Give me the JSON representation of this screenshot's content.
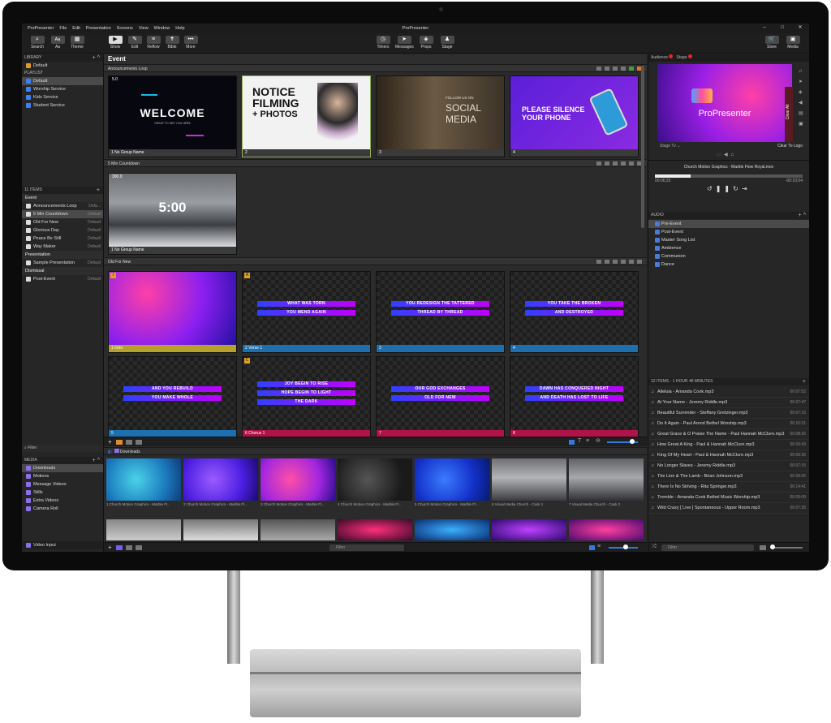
{
  "app": {
    "menu": [
      "ProPresenter",
      "File",
      "Edit",
      "Presentation",
      "Screens",
      "View",
      "Window",
      "Help"
    ],
    "title": "ProPresenter",
    "win_controls": [
      "–",
      "□",
      "✕"
    ]
  },
  "toolbar": {
    "left": [
      "Search",
      "Theme"
    ],
    "left2": [
      "Aa"
    ],
    "mid": [
      "Show",
      "Edit",
      "Reflow",
      "Bible",
      "More"
    ],
    "center": [
      "Timers",
      "Messages",
      "Props",
      "Stage"
    ],
    "right": [
      "Store",
      "Media"
    ],
    "aa_glyph": "Aa"
  },
  "library": {
    "header": "LIBRARY",
    "default": "Default",
    "playlist_header": "PLAYLIST",
    "playlists": [
      "Default",
      "Worship Service",
      "Kids Service",
      "Student Service"
    ]
  },
  "items": {
    "header": "11 ITEMS",
    "groups": [
      {
        "name": "Event",
        "rows": [
          [
            "Announcements Loop",
            "Defa..."
          ],
          [
            "5 Min Countdown",
            "Default"
          ],
          [
            "Old For New",
            "Default"
          ],
          [
            "Glorious Day",
            "Default"
          ],
          [
            "Peace Be Still",
            "Default"
          ],
          [
            "Way Maker",
            "Default"
          ]
        ]
      },
      {
        "name": "Presentation",
        "rows": [
          [
            "Sample Presentation",
            "Default"
          ]
        ]
      },
      {
        "name": "Dismissal",
        "rows": [
          [
            "Post-Event",
            "Default"
          ]
        ]
      }
    ]
  },
  "filter": "Filter",
  "media": {
    "header": "MEDIA",
    "items": [
      "Downloads",
      "Motions",
      "Message Videos",
      "Stills",
      "Extra Videos",
      "Camera Roll"
    ],
    "video_input": "Video Input"
  },
  "center": {
    "title": "Event",
    "g1": "Announcements Loop",
    "g1_badge": "5.0",
    "s1": {
      "welcome": "WELCOME",
      "welcome_sub": "GREAT TO SEE YOU HERE",
      "cap": "1  No Group Name"
    },
    "s2": {
      "l1": "NOTICE",
      "l2": "FILMING",
      "l3": "+ PHOTOS",
      "cap": "2"
    },
    "s3": {
      "l1": "FOLLOW US ON",
      "l2": "SOCIAL",
      "l3": "MEDIA",
      "cap": "3"
    },
    "s4": {
      "l1": "PLEASE SILENCE",
      "l2": "YOUR PHONE",
      "cap": "4"
    },
    "g2": "5 Min Countdown",
    "cd": {
      "badge": "300.0",
      "time": "5:00",
      "cap": "1  No Group Name"
    },
    "g3": "Old For New",
    "slides": [
      {
        "num": "1",
        "label": "Intro",
        "l1": "",
        "l2": "",
        "color": "#b6a12a",
        "letter": "I"
      },
      {
        "num": "2",
        "label": "Verse 1",
        "l1": "WHAT WAS TORN",
        "l2": "YOU MEND AGAIN",
        "color": "#1d6fae",
        "letter": "A"
      },
      {
        "num": "3",
        "label": "",
        "l1": "YOU REDESIGN THE TATTERED",
        "l2": "THREAD BY THREAD",
        "color": "#1d6fae",
        "letter": ""
      },
      {
        "num": "4",
        "label": "",
        "l1": "YOU TAKE THE BROKEN",
        "l2": "AND DESTROYED",
        "color": "#1d6fae",
        "letter": ""
      },
      {
        "num": "5",
        "label": "",
        "l1": "AND YOU REBUILD",
        "l2": "YOU MAKE WHOLE",
        "color": "#1d6fae",
        "letter": ""
      },
      {
        "num": "6",
        "label": "Chorus 1",
        "l1": "JOY BEGIN TO RISE",
        "l2": "HOPE BEGIN TO LIGHT",
        "l3": "THE DARK",
        "color": "#b0124a",
        "letter": "C"
      },
      {
        "num": "7",
        "label": "",
        "l1": "OUR GOD EXCHANGES",
        "l2": "OLD FOR NEW",
        "color": "#b0124a",
        "letter": ""
      },
      {
        "num": "8",
        "label": "",
        "l1": "DAWN HAS CONQUERED NIGHT",
        "l2": "AND DEATH HAS LOST TO LIFE",
        "color": "#b0124a",
        "letter": ""
      }
    ],
    "media_title": "Downloads",
    "videos": [
      "1  Church Motion Graphics - Marble Fl...",
      "2  Church Motion Graphics - Marble Fl...",
      "3  Church Motion Graphics - Marble Fl...",
      "4  Church Motion Graphics - Marble Fl...",
      "5  Church Motion Graphics - Marble Fl...",
      "6  Visual Media Church - Cask 1",
      "7  Visual Media Church - Cask 2"
    ]
  },
  "right": {
    "audience": "Audience",
    "stage": "Stage",
    "preview_logo": "ProPresenter",
    "clear_all": "Clear All",
    "stage_tv": "Stage Tv",
    "clear_logo": "Clear To Logo",
    "now_playing": "Church Motion Graphics - Marble Flow Royal.mov",
    "t_left": "00:06;25",
    "t_right": "-00:23;04",
    "audio_header": "AUDIO",
    "audio_list": [
      "Pre-Event",
      "Post-Event",
      "Master Song List",
      "Ambience",
      "Communion",
      "Dance"
    ],
    "songs_header": "12 ITEMS - 1 HOUR 48 MINUTES",
    "songs": [
      [
        "Alleluia - Amanda Cook.mp3",
        "00:07:52"
      ],
      [
        "At Your Name - Jeremy Riddle.mp3",
        "00:07:47"
      ],
      [
        "Beautiful Surrender - Steffany Gretzinger.mp3",
        "00:07:15"
      ],
      [
        "Do It Again - Paul Arend  Bethel Worship.mp3",
        "00:10:21"
      ],
      [
        "Great Grace & O Praise The Name - Paul  Hannah McClure.mp3",
        "00:08:26"
      ],
      [
        "How Great A King - Paul & Hannah McClure.mp3",
        "00:09:43"
      ],
      [
        "King Of My Heart - Paul & Hannah McClure.mp3",
        "00:09:36"
      ],
      [
        "No Longer Slaves - Jeremy Riddle.mp3",
        "00:07:15"
      ],
      [
        "The Lion & The Lamb - Brian Johnson.mp3",
        "00:09:05"
      ],
      [
        "There Is No Striving - Rita Springer.mp3",
        "00:14:41"
      ],
      [
        "Tremble - Amanda Cook  Bethel Music Worship.mp3",
        "00:09:09"
      ],
      [
        "Wild  Crazy [ Live ]  Spontaneous - Upper Room.mp3",
        "00:07:35"
      ]
    ]
  }
}
